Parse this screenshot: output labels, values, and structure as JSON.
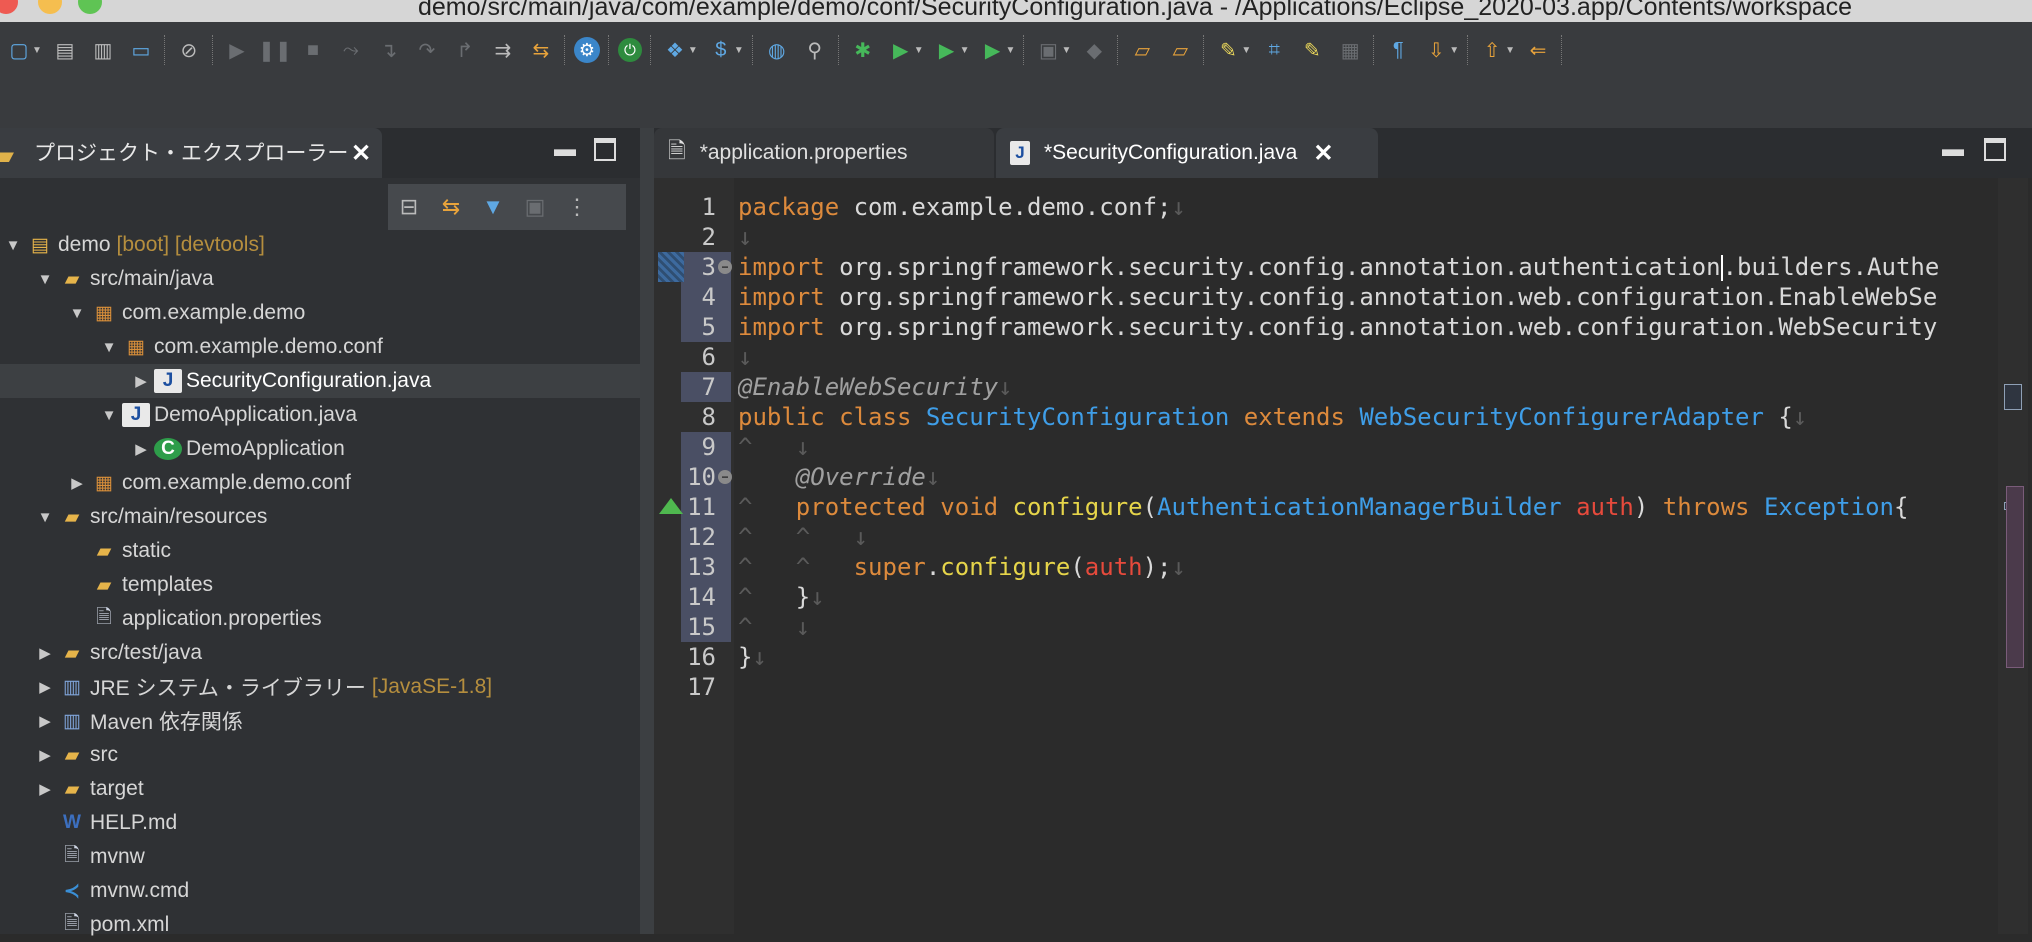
{
  "window": {
    "title": "demo/src/main/java/com/example/demo/conf/SecurityConfiguration.java - /Applications/Eclipse_2020-03.app/Contents/workspace"
  },
  "toolbar": {
    "buttons": [
      {
        "name": "new-icon"
      },
      {
        "name": "save-icon"
      },
      {
        "name": "save-all-icon"
      },
      {
        "name": "open-console-icon"
      },
      {
        "name": "skip-breakpoints-icon"
      },
      {
        "name": "resume-icon"
      },
      {
        "name": "suspend-icon"
      },
      {
        "name": "terminate-icon"
      },
      {
        "name": "disconnect-icon"
      },
      {
        "name": "step-into-icon"
      },
      {
        "name": "step-over-icon"
      },
      {
        "name": "step-return-icon"
      },
      {
        "name": "drop-to-frame-icon"
      },
      {
        "name": "use-step-filters-icon"
      },
      {
        "name": "spring-settings-icon"
      },
      {
        "name": "relaunch-icon"
      },
      {
        "name": "new-spring-starter-icon"
      },
      {
        "name": "spring-icon"
      },
      {
        "name": "globe-icon"
      },
      {
        "name": "search-icon"
      },
      {
        "name": "debug-icon"
      },
      {
        "name": "run-icon"
      },
      {
        "name": "coverage-icon"
      },
      {
        "name": "external-tools-icon"
      },
      {
        "name": "new-java-project-icon"
      },
      {
        "name": "new-package-icon"
      },
      {
        "name": "open-type-icon"
      },
      {
        "name": "open-task-icon"
      },
      {
        "name": "highlighter-icon"
      },
      {
        "name": "breadcrumb-icon"
      },
      {
        "name": "toggle-mark-icon"
      },
      {
        "name": "block-selection-icon"
      },
      {
        "name": "show-whitespace-icon"
      },
      {
        "name": "next-annotation-icon"
      },
      {
        "name": "previous-annotation-icon"
      },
      {
        "name": "back-icon"
      }
    ]
  },
  "left_panel": {
    "tab_label": "プロジェクト・エクスプローラー",
    "tree": [
      {
        "id": "demo",
        "label": "demo",
        "decoration": "[boot] [devtools]",
        "indent": 0,
        "expanded": true,
        "icon": "project-icon"
      },
      {
        "id": "src-main-java",
        "label": "src/main/java",
        "indent": 1,
        "expanded": true,
        "icon": "source-folder-icon"
      },
      {
        "id": "pkg-demo",
        "label": "com.example.demo",
        "indent": 2,
        "expanded": true,
        "icon": "package-icon"
      },
      {
        "id": "pkg-demo-conf",
        "label": "com.example.demo.conf",
        "indent": 3,
        "expanded": true,
        "icon": "package-icon"
      },
      {
        "id": "security-config",
        "label": "SecurityConfiguration.java",
        "indent": 4,
        "expanded": false,
        "selected": true,
        "icon": "java-file-icon"
      },
      {
        "id": "demo-app-java",
        "label": "DemoApplication.java",
        "indent": 3,
        "expanded": true,
        "icon": "java-file-icon"
      },
      {
        "id": "demo-app-class",
        "label": "DemoApplication",
        "indent": 4,
        "expanded": false,
        "icon": "class-icon"
      },
      {
        "id": "pkg-demo-conf-2",
        "label": "com.example.demo.conf",
        "indent": 2,
        "expanded": false,
        "icon": "package-icon"
      },
      {
        "id": "src-main-resources",
        "label": "src/main/resources",
        "indent": 1,
        "expanded": true,
        "icon": "source-folder-icon"
      },
      {
        "id": "static",
        "label": "static",
        "indent": 2,
        "leaf": true,
        "icon": "folder-icon"
      },
      {
        "id": "templates",
        "label": "templates",
        "indent": 2,
        "leaf": true,
        "icon": "folder-icon"
      },
      {
        "id": "app-props",
        "label": "application.properties",
        "indent": 2,
        "leaf": true,
        "icon": "properties-file-icon"
      },
      {
        "id": "src-test-java",
        "label": "src/test/java",
        "indent": 1,
        "expanded": false,
        "icon": "source-folder-icon"
      },
      {
        "id": "jre",
        "label": "JRE システム・ライブラリー",
        "decoration": "[JavaSE-1.8]",
        "indent": 1,
        "expanded": false,
        "icon": "library-icon"
      },
      {
        "id": "maven",
        "label": "Maven 依存関係",
        "indent": 1,
        "expanded": false,
        "icon": "library-icon"
      },
      {
        "id": "src",
        "label": "src",
        "indent": 1,
        "expanded": false,
        "icon": "folder-icon"
      },
      {
        "id": "target",
        "label": "target",
        "indent": 1,
        "expanded": false,
        "icon": "folder-icon"
      },
      {
        "id": "help-md",
        "label": "HELP.md",
        "indent": 1,
        "leaf": true,
        "icon": "word-file-icon"
      },
      {
        "id": "mvnw",
        "label": "mvnw",
        "indent": 1,
        "leaf": true,
        "icon": "text-file-icon"
      },
      {
        "id": "mvnw-cmd",
        "label": "mvnw.cmd",
        "indent": 1,
        "leaf": true,
        "icon": "vscode-file-icon"
      },
      {
        "id": "pom",
        "label": "pom.xml",
        "indent": 1,
        "leaf": true,
        "icon": "xml-file-icon"
      }
    ]
  },
  "editor": {
    "tabs": [
      {
        "label": "*application.properties",
        "active": false
      },
      {
        "label": "*SecurityConfiguration.java",
        "active": true
      }
    ],
    "lines": [
      {
        "n": "1",
        "tokens": [
          [
            "kw",
            "package"
          ],
          [
            "plain",
            " com.example.demo.conf;"
          ],
          [
            "sym",
            "↓"
          ]
        ]
      },
      {
        "n": "2",
        "tokens": [
          [
            "sym",
            "↓"
          ]
        ]
      },
      {
        "n": "3",
        "tokens": [
          [
            "kw",
            "import"
          ],
          [
            "plain",
            " org.springframework.security.config.annotation.authentication"
          ],
          [
            "caret",
            ""
          ],
          [
            "plain",
            ".builders.AuthenticationManagerBuilder;"
          ]
        ]
      },
      {
        "n": "4",
        "tokens": [
          [
            "kw",
            "import"
          ],
          [
            "plain",
            " org.springframework.security.config.annotation.web.configuration.EnableWebSecurity;"
          ]
        ]
      },
      {
        "n": "5",
        "tokens": [
          [
            "kw",
            "import"
          ],
          [
            "plain",
            " org.springframework.security.config.annotation.web.configuration.WebSecurityConfigurerAdapter;"
          ]
        ]
      },
      {
        "n": "6",
        "tokens": [
          [
            "sym",
            "↓"
          ]
        ]
      },
      {
        "n": "7",
        "tokens": [
          [
            "anno",
            "@EnableWebSecurity"
          ],
          [
            "sym",
            "↓"
          ]
        ]
      },
      {
        "n": "8",
        "tokens": [
          [
            "kw",
            "public"
          ],
          [
            "plain",
            " "
          ],
          [
            "kw",
            "class"
          ],
          [
            "plain",
            " "
          ],
          [
            "type",
            "SecurityConfiguration"
          ],
          [
            "plain",
            " "
          ],
          [
            "kw",
            "extends"
          ],
          [
            "plain",
            " "
          ],
          [
            "type",
            "WebSecurityConfigurerAdapter"
          ],
          [
            "plain",
            " {"
          ],
          [
            "sym",
            "↓"
          ]
        ]
      },
      {
        "n": "9",
        "tokens": [
          [
            "sym",
            "^   ↓"
          ]
        ]
      },
      {
        "n": "10",
        "tokens": [
          [
            "sym",
            "    "
          ],
          [
            "anno",
            "@Override"
          ],
          [
            "sym",
            "↓"
          ]
        ]
      },
      {
        "n": "11",
        "tokens": [
          [
            "sym",
            "^   "
          ],
          [
            "kw",
            "protected"
          ],
          [
            "plain",
            " "
          ],
          [
            "kw",
            "void"
          ],
          [
            "plain",
            " "
          ],
          [
            "method",
            "configure"
          ],
          [
            "plain",
            "("
          ],
          [
            "type",
            "AuthenticationManagerBuilder"
          ],
          [
            "plain",
            " "
          ],
          [
            "param",
            "auth"
          ],
          [
            "plain",
            ") "
          ],
          [
            "kw",
            "throws"
          ],
          [
            "plain",
            " "
          ],
          [
            "type",
            "Exception"
          ],
          [
            "plain",
            "{"
          ]
        ]
      },
      {
        "n": "12",
        "tokens": [
          [
            "sym",
            "^   ^   ↓"
          ]
        ]
      },
      {
        "n": "13",
        "tokens": [
          [
            "sym",
            "^   ^   "
          ],
          [
            "kw",
            "super"
          ],
          [
            "plain",
            "."
          ],
          [
            "method",
            "configure"
          ],
          [
            "plain",
            "("
          ],
          [
            "param",
            "auth"
          ],
          [
            "plain",
            ");"
          ],
          [
            "sym",
            "↓"
          ]
        ]
      },
      {
        "n": "14",
        "tokens": [
          [
            "sym",
            "^   "
          ],
          [
            "plain",
            "}"
          ],
          [
            "sym",
            "↓"
          ]
        ]
      },
      {
        "n": "15",
        "tokens": [
          [
            "sym",
            "^   ↓"
          ]
        ]
      },
      {
        "n": "16",
        "tokens": [
          [
            "plain",
            "}"
          ],
          [
            "sym",
            "↓"
          ]
        ]
      },
      {
        "n": "17",
        "tokens": []
      }
    ]
  }
}
